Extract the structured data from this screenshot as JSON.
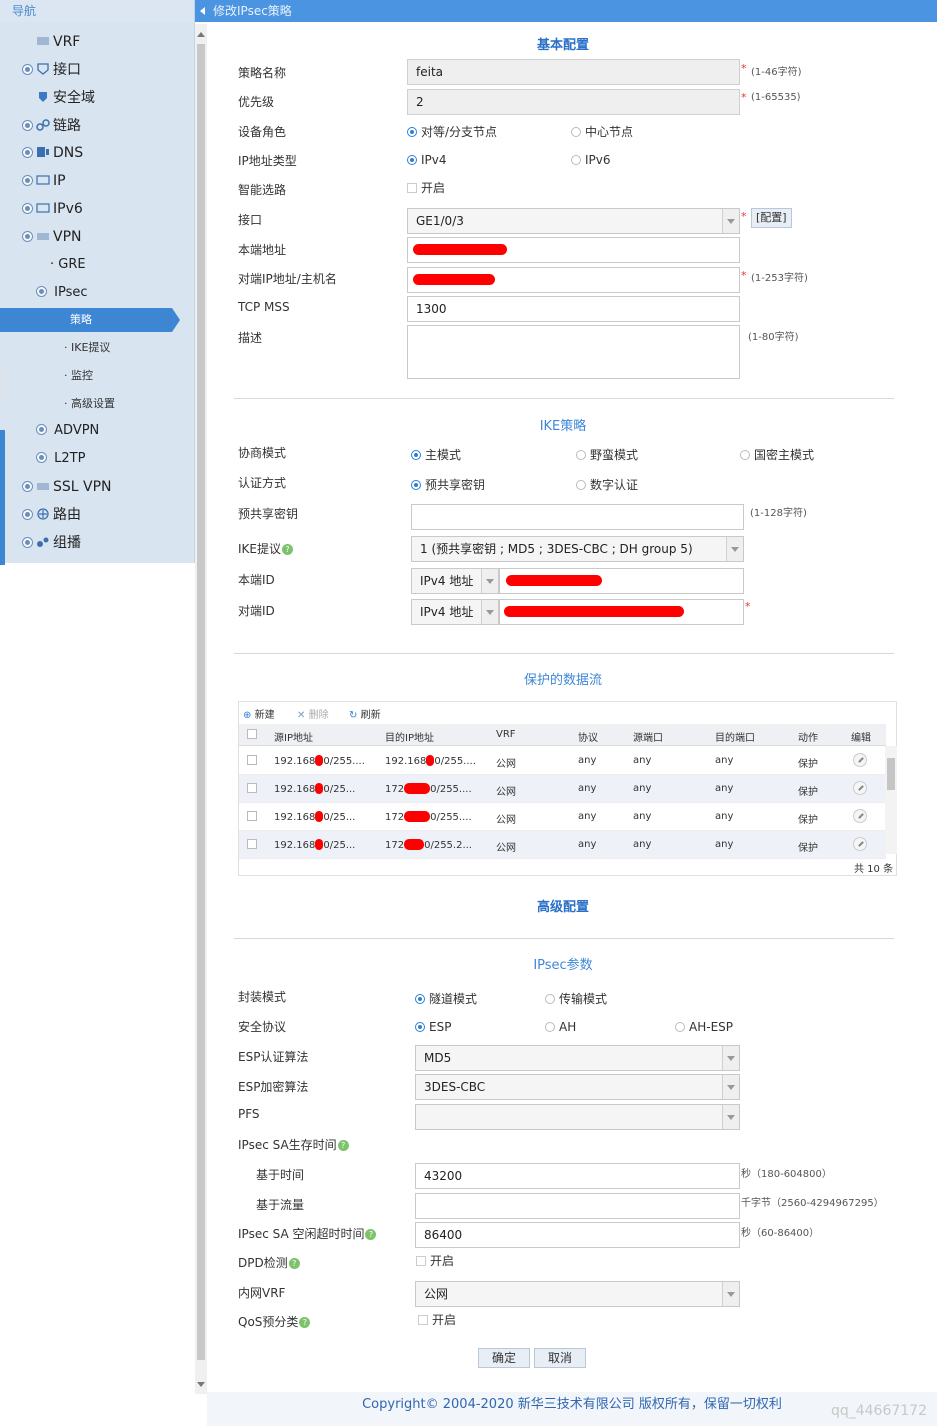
{
  "nav": {
    "header": "导航",
    "items": [
      {
        "label": "VRF"
      },
      {
        "label": "接口"
      },
      {
        "label": "安全域"
      },
      {
        "label": "链路"
      },
      {
        "label": "DNS"
      },
      {
        "label": "IP"
      },
      {
        "label": "IPv6"
      },
      {
        "label": "VPN"
      },
      {
        "label": "GRE"
      },
      {
        "label": "IPsec"
      },
      {
        "label": "策略"
      },
      {
        "label": "IKE提议"
      },
      {
        "label": "监控"
      },
      {
        "label": "高级设置"
      },
      {
        "label": "ADVPN"
      },
      {
        "label": "L2TP"
      },
      {
        "label": "SSL VPN"
      },
      {
        "label": "路由"
      },
      {
        "label": "组播"
      }
    ]
  },
  "page": {
    "title": "修改IPsec策略"
  },
  "basic": {
    "section": "基本配置",
    "name_label": "策略名称",
    "name_value": "feita",
    "name_hint": "(1-46字符)",
    "priority_label": "优先级",
    "priority_value": "2",
    "priority_hint": "(1-65535)",
    "role_label": "设备角色",
    "role_opt1": "对等/分支节点",
    "role_opt2": "中心节点",
    "iptype_label": "IP地址类型",
    "iptype_opt1": "IPv4",
    "iptype_opt2": "IPv6",
    "smart_label": "智能选路",
    "smart_check": "开启",
    "iface_label": "接口",
    "iface_value": "GE1/0/3",
    "iface_config": "[配置]",
    "local_label": "本端地址",
    "peer_label": "对端IP地址/主机名",
    "peer_hint": "(1-253字符)",
    "mss_label": "TCP MSS",
    "mss_value": "1300",
    "desc_label": "描述",
    "desc_hint": "(1-80字符)"
  },
  "ike": {
    "section": "IKE策略",
    "mode_label": "协商模式",
    "mode_opt1": "主模式",
    "mode_opt2": "野蛮模式",
    "mode_opt3": "国密主模式",
    "auth_label": "认证方式",
    "auth_opt1": "预共享密钥",
    "auth_opt2": "数字认证",
    "psk_label": "预共享密钥",
    "psk_hint": "(1-128字符)",
    "proposal_label": "IKE提议",
    "proposal_value": "1 (预共享密钥 ; MD5 ; 3DES-CBC ; DH group 5)",
    "localid_label": "本端ID",
    "localid_type": "IPv4 地址",
    "peerid_label": "对端ID",
    "peerid_type": "IPv4 地址"
  },
  "flow": {
    "section": "保护的数据流",
    "btn_new": "新建",
    "btn_delete": "删除",
    "btn_refresh": "刷新",
    "columns": [
      "源IP地址",
      "目的IP地址",
      "VRF",
      "协议",
      "源端口",
      "目的端口",
      "动作",
      "编辑"
    ],
    "rows": [
      [
        "192.168",
        "0/255....",
        "192.168",
        "0/255....",
        "公网",
        "any",
        "any",
        "any",
        "保护"
      ],
      [
        "192.168",
        "0/25...",
        "172",
        "0/255....",
        "公网",
        "any",
        "any",
        "any",
        "保护"
      ],
      [
        "192.168",
        "0/25...",
        "172",
        "0/255....",
        "公网",
        "any",
        "any",
        "any",
        "保护"
      ],
      [
        "192.168",
        "0/25...",
        "172",
        "0/255.2...",
        "公网",
        "any",
        "any",
        "any",
        "保护"
      ]
    ],
    "total": "共 10 条"
  },
  "advanced": {
    "section": "高级配置"
  },
  "ipsec": {
    "section": "IPsec参数",
    "encap_label": "封装模式",
    "encap_opt1": "隧道模式",
    "encap_opt2": "传输模式",
    "proto_label": "安全协议",
    "proto_opt1": "ESP",
    "proto_opt2": "AH",
    "proto_opt3": "AH-ESP",
    "espauth_label": "ESP认证算法",
    "espauth_value": "MD5",
    "espenc_label": "ESP加密算法",
    "espenc_value": "3DES-CBC",
    "pfs_label": "PFS",
    "pfs_value": "",
    "lifetime_label": "IPsec SA生存时间",
    "time_label": "基于时间",
    "time_value": "43200",
    "time_hint": "秒（180-604800）",
    "traffic_label": "基于流量",
    "traffic_value": "",
    "traffic_hint": "千字节（2560-4294967295）",
    "idle_label": "IPsec SA 空闲超时时间",
    "idle_value": "86400",
    "idle_hint": "秒（60-86400）",
    "dpd_label": "DPD检测",
    "dpd_check": "开启",
    "vrf_label": "内网VRF",
    "vrf_value": "公网",
    "qos_label": "QoS预分类",
    "qos_check": "开启"
  },
  "actions": {
    "ok": "确定",
    "cancel": "取消"
  },
  "footer": {
    "copyright": "Copyright© 2004-2020 新华三技术有限公司 版权所有，保留一切权利",
    "watermark": "qq_44667172"
  },
  "colors": {
    "accent": "#3d86d4",
    "title_bar": "#4a94e2",
    "redaction": "#ff0000"
  }
}
